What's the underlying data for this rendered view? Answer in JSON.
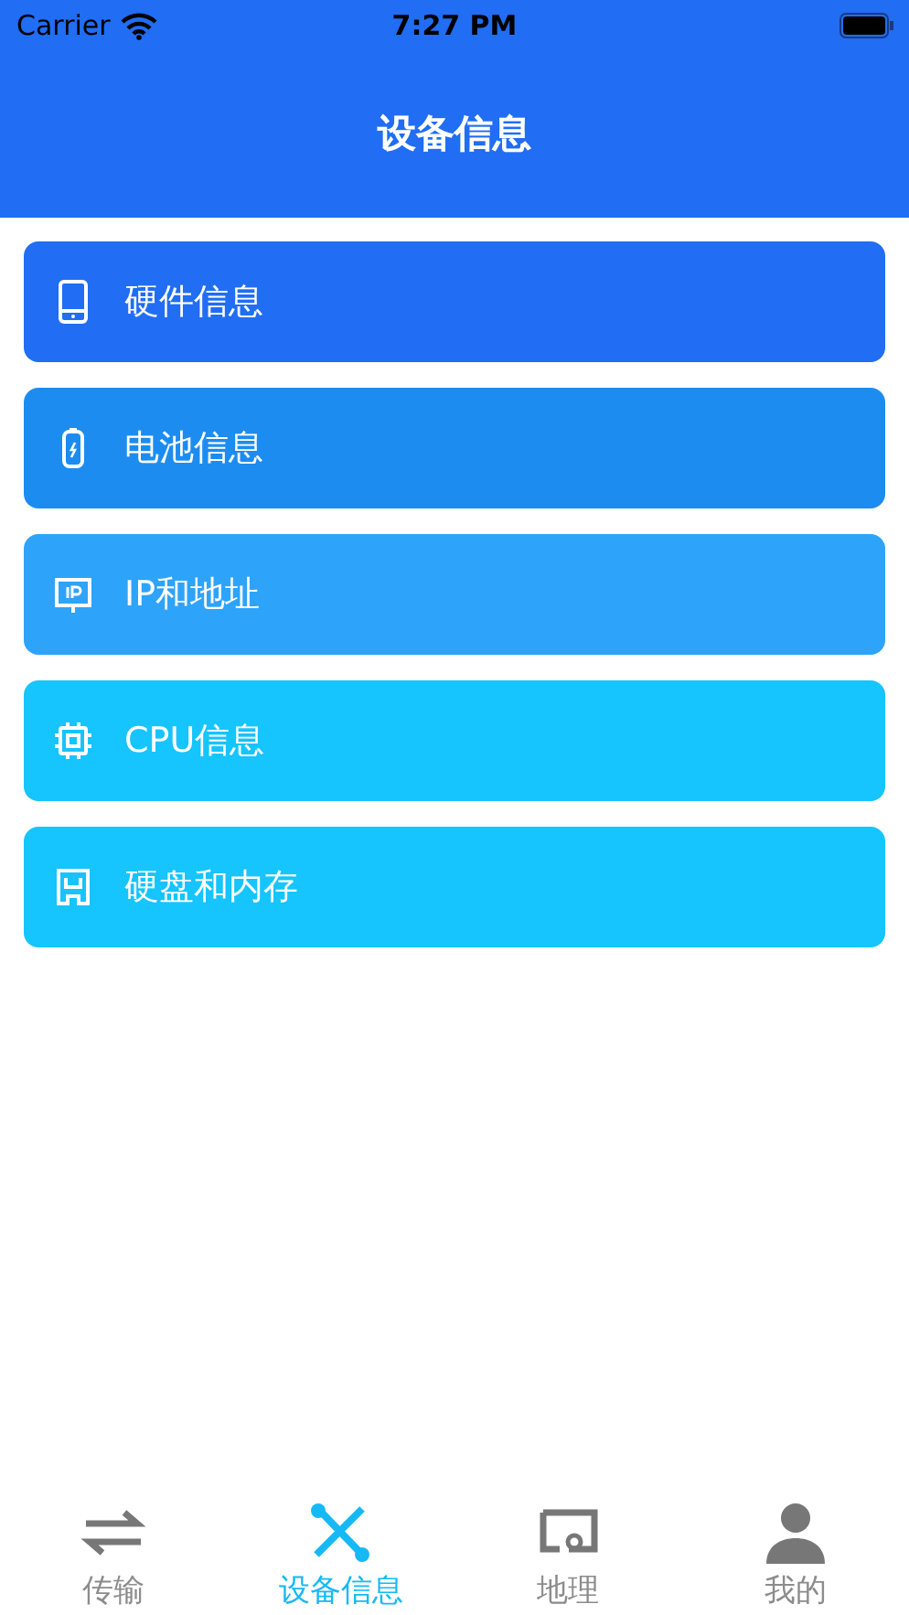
{
  "status_bar": {
    "carrier": "Carrier",
    "time": "7:27 PM"
  },
  "header": {
    "title": "设备信息"
  },
  "items": [
    {
      "label": "硬件信息",
      "kind": "phone",
      "color": "#216df4"
    },
    {
      "label": "电池信息",
      "kind": "battery",
      "color": "#1c8cf0"
    },
    {
      "label": "IP和地址",
      "kind": "ip",
      "color": "#2ea3fa"
    },
    {
      "label": "CPU信息",
      "kind": "cpu",
      "color": "#16c4fe"
    },
    {
      "label": "硬盘和内存",
      "kind": "disk",
      "color": "#16c4fe"
    }
  ],
  "tabs": [
    {
      "label": "传输",
      "kind": "transfer",
      "selected": false
    },
    {
      "label": "设备信息",
      "kind": "tools",
      "selected": true
    },
    {
      "label": "地理",
      "kind": "map",
      "selected": false
    },
    {
      "label": "我的",
      "kind": "person",
      "selected": false
    }
  ]
}
